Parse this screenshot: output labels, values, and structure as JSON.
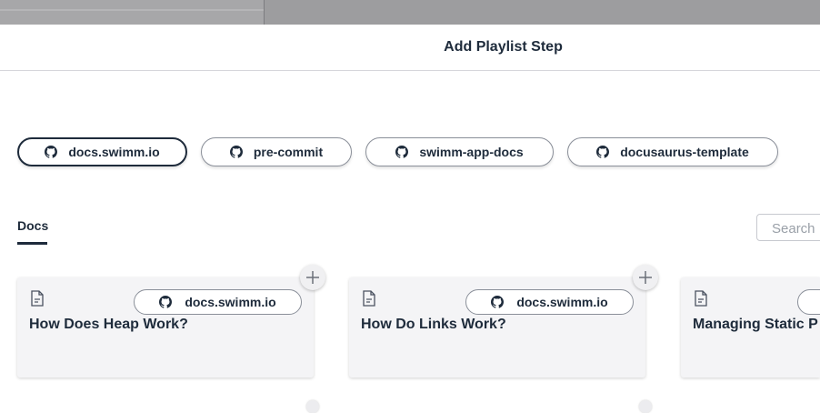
{
  "dialog": {
    "title": "Add Playlist Step"
  },
  "repos": [
    {
      "label": "docs.swimm.io",
      "selected": true
    },
    {
      "label": "pre-commit",
      "selected": false
    },
    {
      "label": "swimm-app-docs",
      "selected": false
    },
    {
      "label": "docusaurus-template",
      "selected": false
    }
  ],
  "tabs": {
    "active": "Docs"
  },
  "search": {
    "placeholder": "Search"
  },
  "cards": [
    {
      "title": "How Does Heap Work?",
      "repo": "docs.swimm.io"
    },
    {
      "title": "How Do Links Work?",
      "repo": "docs.swimm.io"
    },
    {
      "title": "Managing Static P",
      "repo": ""
    }
  ],
  "icons": {
    "repo": "github-icon",
    "doc": "document-icon",
    "add": "plus-icon"
  }
}
